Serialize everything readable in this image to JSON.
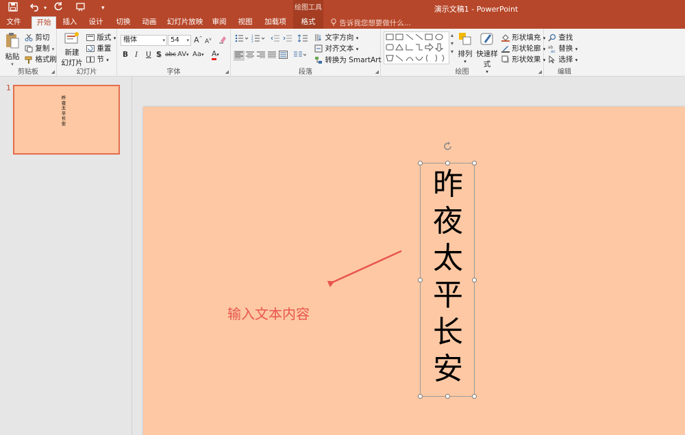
{
  "titlebar": {
    "app_title": "演示文稿1 - PowerPoint",
    "contextual_tab_group": "绘图工具",
    "qat": [
      "save-icon",
      "undo-icon",
      "redo-icon",
      "presentation-icon",
      "customize-icon"
    ]
  },
  "tabs": [
    {
      "label": "文件"
    },
    {
      "label": "开始"
    },
    {
      "label": "插入"
    },
    {
      "label": "设计"
    },
    {
      "label": "切换"
    },
    {
      "label": "动画"
    },
    {
      "label": "幻灯片放映"
    },
    {
      "label": "审阅"
    },
    {
      "label": "视图"
    },
    {
      "label": "加载项"
    },
    {
      "label": "格式"
    }
  ],
  "active_tab": "开始",
  "tell_me_placeholder": "告诉我您想要做什么...",
  "ribbon": {
    "clipboard": {
      "paste": "粘贴",
      "cut": "剪切",
      "copy": "复制",
      "format_painter": "格式刷",
      "label": "剪贴板"
    },
    "slides": {
      "new_slide_line1": "新建",
      "new_slide_line2": "幻灯片",
      "layout": "版式",
      "reset": "重置",
      "section": "节",
      "label": "幻灯片"
    },
    "font": {
      "font_name": "楷体",
      "font_size": "54",
      "bold": "B",
      "italic": "I",
      "underline": "U",
      "shadow": "S",
      "strike": "abc",
      "spacing": "AV",
      "case": "Aa",
      "color": "A",
      "grow": "A",
      "shrink": "A",
      "label": "字体"
    },
    "paragraph": {
      "text_direction": "文字方向",
      "align_text": "对齐文本",
      "convert_smartart": "转换为 SmartArt",
      "label": "段落"
    },
    "drawing": {
      "arrange": "排列",
      "quick_styles": "快速样式",
      "shape_fill": "形状填充",
      "shape_outline": "形状轮廓",
      "shape_effects": "形状效果",
      "label": "绘图"
    },
    "editing": {
      "find": "查找",
      "replace": "替换",
      "select": "选择",
      "label": "编辑"
    }
  },
  "slides_pane": {
    "slide_number": "1",
    "thumbnail_text": "昨夜太平长安"
  },
  "slide": {
    "vertical_text": "昨夜太平长安",
    "annotation_text": "输入文本内容",
    "annotation_color": "#e8554e",
    "background_color": "#fdc8a3"
  },
  "colors": {
    "accent": "#b7472a",
    "font_color_bar": "#e8221c"
  }
}
